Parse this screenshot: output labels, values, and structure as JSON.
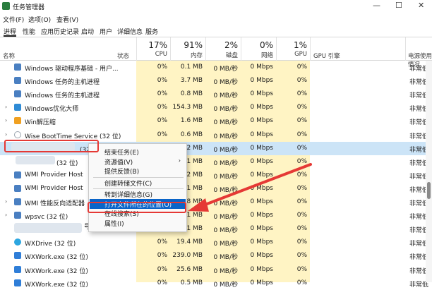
{
  "window": {
    "title": "任务管理器",
    "controls": [
      "—",
      "☐",
      "✕"
    ]
  },
  "menu": [
    {
      "label": "文件(F)"
    },
    {
      "label": "选项(O)"
    },
    {
      "label": "查看(V)"
    }
  ],
  "tabs": [
    {
      "label": "进程",
      "active": true
    },
    {
      "label": "性能"
    },
    {
      "label": "应用历史记录"
    },
    {
      "label": "启动"
    },
    {
      "label": "用户"
    },
    {
      "label": "详细信息"
    },
    {
      "label": "服务"
    }
  ],
  "header": {
    "name": "名称",
    "status": "状态",
    "cpu": {
      "pct": "17%",
      "label": "CPU"
    },
    "mem": {
      "pct": "91%",
      "label": "内存"
    },
    "disk": {
      "pct": "2%",
      "label": "磁盘"
    },
    "net": {
      "pct": "0%",
      "label": "网络"
    },
    "gpu": {
      "pct": "1%",
      "label": "GPU"
    },
    "gpu_engine": "GPU 引擎",
    "power": "电源使用情况"
  },
  "rows": [
    {
      "expand": "",
      "icon": "window",
      "color": "#4a7fc1",
      "name": "Windows 驱动程序基础 - 用户...",
      "cpu": "0%",
      "mem": "0.1 MB",
      "disk": "0 MB/秒",
      "net": "0 Mbps",
      "gpu": "0%",
      "engine": "非常低"
    },
    {
      "expand": "",
      "icon": "window",
      "color": "#4a7fc1",
      "name": "Windows 任务的主机进程",
      "cpu": "0%",
      "mem": "3.7 MB",
      "disk": "0 MB/秒",
      "net": "0 Mbps",
      "gpu": "0%",
      "engine": "非常低"
    },
    {
      "expand": "",
      "icon": "window",
      "color": "#4a7fc1",
      "name": "Windows 任务的主机进程",
      "cpu": "0%",
      "mem": "0.8 MB",
      "disk": "0 MB/秒",
      "net": "0 Mbps",
      "gpu": "0%",
      "engine": "非常低"
    },
    {
      "expand": "›",
      "icon": "app",
      "color": "#2e8bd6",
      "name": "Windows优化大师",
      "cpu": "0%",
      "mem": "154.3 MB",
      "disk": "0 MB/秒",
      "net": "0 Mbps",
      "gpu": "0%",
      "engine": "非常低"
    },
    {
      "expand": "›",
      "icon": "app",
      "color": "#f0a020",
      "name": "Win解压缩",
      "cpu": "0%",
      "mem": "1.6 MB",
      "disk": "0 MB/秒",
      "net": "0 Mbps",
      "gpu": "0%",
      "engine": "非常低"
    },
    {
      "expand": "›",
      "icon": "search",
      "color": "#9aa4ae",
      "name": "Wise BootTime Service (32 位)",
      "cpu": "0%",
      "mem": "0.6 MB",
      "disk": "0 MB/秒",
      "net": "0 Mbps",
      "gpu": "0%",
      "engine": "非常低"
    },
    {
      "expand": "",
      "icon": "",
      "color": "",
      "name": "(32 位)",
      "cpu": "0.6%",
      "mem": "13.2 MB",
      "disk": "0 MB/秒",
      "net": "0 Mbps",
      "gpu": "0%",
      "engine": "非常低",
      "selected": true
    },
    {
      "expand": "",
      "icon": "",
      "color": "",
      "name": "(32 位)",
      "cpu": "0%",
      "mem": "0.1 MB",
      "disk": "0 MB/秒",
      "net": "0 Mbps",
      "gpu": "0%",
      "engine": "非常低"
    },
    {
      "expand": "",
      "icon": "window",
      "color": "#4a7fc1",
      "name": "WMI Provider Host",
      "cpu": "0%",
      "mem": "1.2 MB",
      "disk": "0 MB/秒",
      "net": "0 Mbps",
      "gpu": "0%",
      "engine": "非常低"
    },
    {
      "expand": "",
      "icon": "window",
      "color": "#4a7fc1",
      "name": "WMI Provider Host",
      "cpu": "0%",
      "mem": "2.1 MB",
      "disk": "0 MB/秒",
      "net": "0 Mbps",
      "gpu": "0%",
      "engine": "非常低"
    },
    {
      "expand": "›",
      "icon": "window",
      "color": "#4a7fc1",
      "name": "WMI 性能反向适配器",
      "cpu": "0%",
      "mem": "0.8 MB",
      "disk": "0 MB/秒",
      "net": "0 Mbps",
      "gpu": "0%",
      "engine": "非常低"
    },
    {
      "expand": "›",
      "icon": "window",
      "color": "#4a7fc1",
      "name": "wpsvc (32 位)",
      "cpu": "0%",
      "mem": "0.1 MB",
      "disk": "0 MB/秒",
      "net": "0 Mbps",
      "gpu": "0%",
      "engine": "非常低"
    },
    {
      "expand": "",
      "icon": "",
      "color": "",
      "name": "号",
      "cpu": "0%",
      "mem": "0.1 MB",
      "disk": "0 MB/秒",
      "net": "0 Mbps",
      "gpu": "0%",
      "engine": "非常低"
    },
    {
      "expand": "",
      "icon": "cloud",
      "color": "#2ca6e0",
      "name": "WXDrive (32 位)",
      "cpu": "0%",
      "mem": "19.4 MB",
      "disk": "0 MB/秒",
      "net": "0 Mbps",
      "gpu": "0%",
      "engine": "非常低"
    },
    {
      "expand": "",
      "icon": "chat",
      "color": "#2f7ed8",
      "name": "WXWork.exe (32 位)",
      "cpu": "0%",
      "mem": "239.0 MB",
      "disk": "0 MB/秒",
      "net": "0 Mbps",
      "gpu": "0%",
      "engine": "非常低"
    },
    {
      "expand": "",
      "icon": "chat",
      "color": "#2f7ed8",
      "name": "WXWork.exe (32 位)",
      "cpu": "0%",
      "mem": "25.6 MB",
      "disk": "0 MB/秒",
      "net": "0 Mbps",
      "gpu": "0%",
      "engine": "非常低"
    },
    {
      "expand": "",
      "icon": "chat",
      "color": "#2f7ed8",
      "name": "WXWork.exe (32 位)",
      "cpu": "0%",
      "mem": "0.5 MB",
      "disk": "0 MB/秒",
      "net": "0 Mbps",
      "gpu": "0%",
      "engine": "非常低"
    }
  ],
  "context_menu": [
    {
      "label": "结束任务(E)"
    },
    {
      "label": "资源值(V)",
      "submenu": true
    },
    {
      "label": "提供反馈(B)"
    },
    {
      "sep": true
    },
    {
      "label": "创建转储文件(C)"
    },
    {
      "sep": true
    },
    {
      "label": "转到详细信息(G)"
    },
    {
      "label": "打开文件所在的位置(O)",
      "highlighted": true
    },
    {
      "label": "在线搜索(S)"
    },
    {
      "label": "属性(I)"
    }
  ],
  "colors": {
    "accent": "#0a64c8",
    "annotation": "#e53935",
    "heat": "#fff4c4",
    "selected_row": "#cce4f7"
  }
}
